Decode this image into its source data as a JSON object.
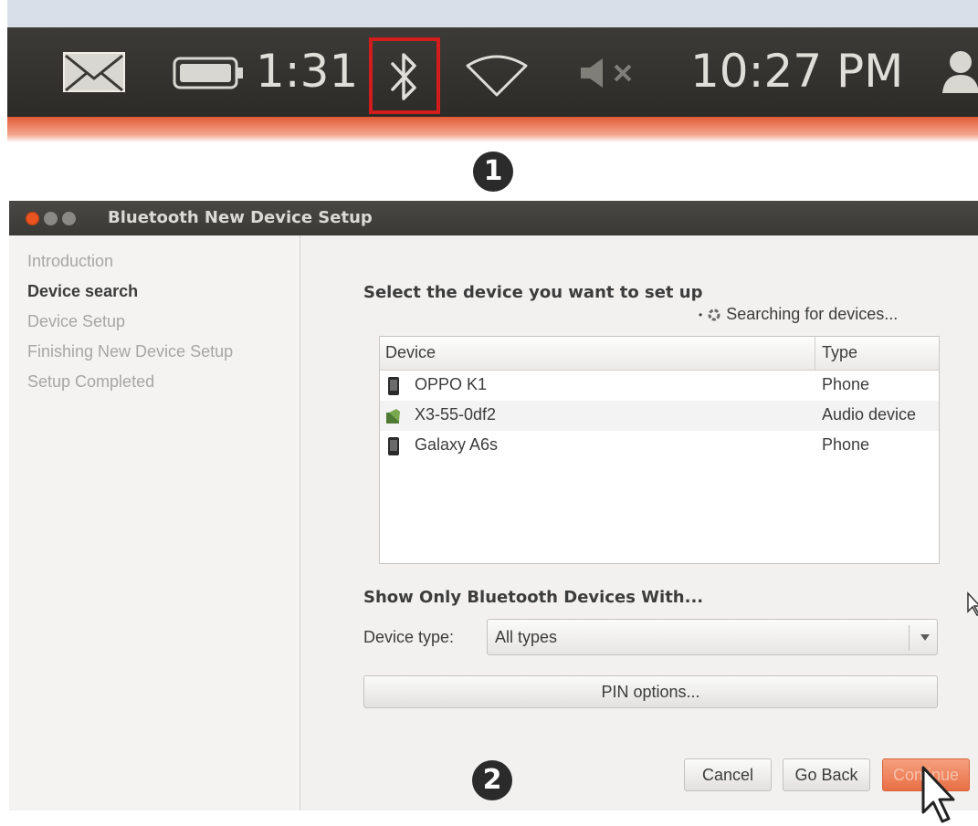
{
  "panel": {
    "battery_time": "1:31",
    "clock": "10:27 PM",
    "icons": [
      "mail-icon",
      "battery-icon",
      "bluetooth-icon",
      "wifi-icon",
      "sound-muted-icon",
      "user-icon"
    ],
    "highlight_color": "#d31c1c"
  },
  "markers": {
    "step1": "1",
    "step2": "2"
  },
  "dialog": {
    "title": "Bluetooth New Device Setup",
    "sidebar": {
      "items": [
        {
          "label": "Introduction",
          "active": false
        },
        {
          "label": "Device search",
          "active": true
        },
        {
          "label": "Device Setup",
          "active": false
        },
        {
          "label": "Finishing New Device Setup",
          "active": false
        },
        {
          "label": "Setup Completed",
          "active": false
        }
      ]
    },
    "main": {
      "heading": "Select the device you want to set up",
      "status": "Searching for devices...",
      "table": {
        "columns": [
          "Device",
          "Type"
        ],
        "rows": [
          {
            "icon": "phone-icon",
            "name": "OPPO K1",
            "type": "Phone"
          },
          {
            "icon": "audio-device-icon",
            "name": "X3-55-0df2",
            "type": "Audio device"
          },
          {
            "icon": "phone-icon",
            "name": "Galaxy A6s",
            "type": "Phone"
          }
        ]
      },
      "filter_heading": "Show Only Bluetooth Devices With...",
      "device_type_label": "Device type:",
      "device_type_value": "All types",
      "pin_options_label": "PIN options...",
      "buttons": {
        "cancel": "Cancel",
        "go_back": "Go Back",
        "continue": "Continue"
      }
    },
    "colors": {
      "accent": "#e95420",
      "titlebar": "#3a3935"
    }
  }
}
